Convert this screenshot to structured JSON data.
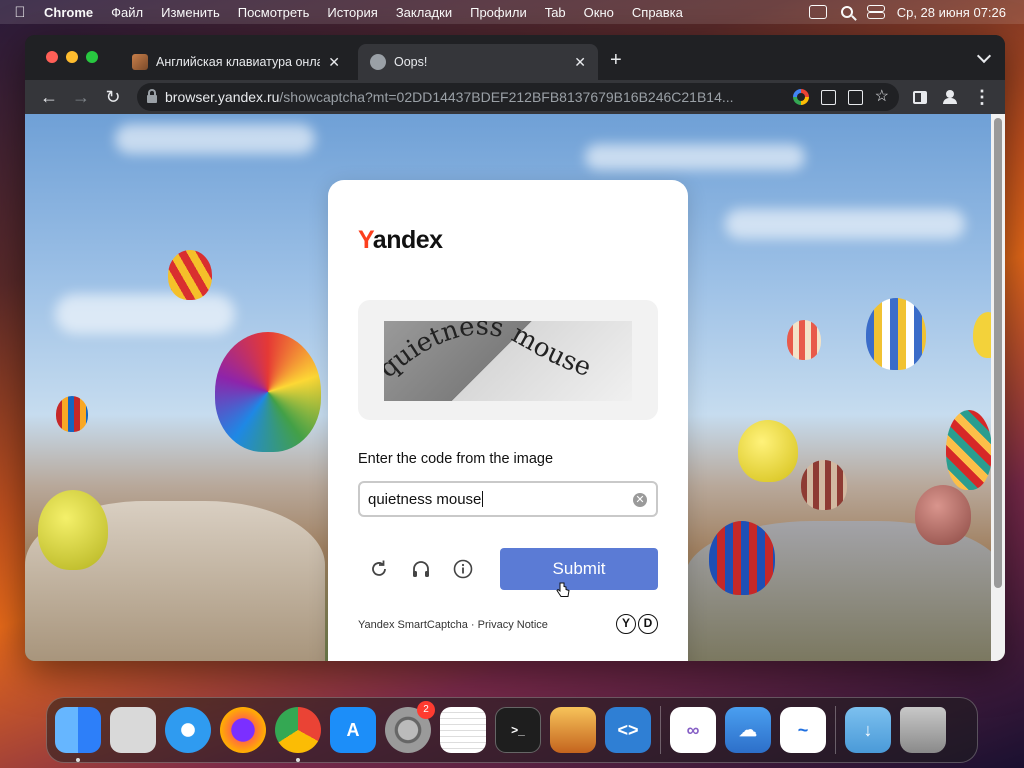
{
  "menubar": {
    "app_name": "Chrome",
    "items": [
      "Файл",
      "Изменить",
      "Посмотреть",
      "История",
      "Закладки",
      "Профили",
      "Tab",
      "Окно",
      "Справка"
    ],
    "datetime": "Ср, 28 июня  07:26"
  },
  "browser": {
    "tabs": [
      {
        "title": "Английская клавиатура онлайн",
        "favicon": "tab-favicon"
      },
      {
        "title": "Oops!",
        "favicon": "globe-icon"
      }
    ],
    "new_tab_label": "+",
    "url_host": "browser.yandex.ru",
    "url_path": "/showcaptcha?mt=02DD14437BDEF212BFB8137679B16B246C21B14..."
  },
  "page": {
    "logo_y": "Y",
    "logo_rest": "andex",
    "captcha_text": "quietness mouse",
    "input_label": "Enter the code from the image",
    "input_value": "quietness mouse",
    "submit_label": "Submit",
    "footer_text": "Yandex SmartCaptcha · Privacy Notice",
    "footer_logo_1": "Y",
    "footer_logo_2": "D"
  },
  "dock": {
    "apps": [
      {
        "name": "Finder",
        "color": "#3b82f6"
      },
      {
        "name": "Launchpad",
        "color": "#cfcfcf"
      },
      {
        "name": "Safari",
        "color": "#2f9bf0"
      },
      {
        "name": "Firefox",
        "color": "#ff7139"
      },
      {
        "name": "Chrome",
        "color": "#ffffff"
      },
      {
        "name": "App Store",
        "color": "#1c8ef9"
      },
      {
        "name": "System Settings",
        "color": "#8e8e93",
        "badge": "2"
      },
      {
        "name": "TextEdit",
        "color": "#f5f5f5"
      },
      {
        "name": "Terminal",
        "color": "#1e1e1e"
      },
      {
        "name": "GarageBand",
        "color": "#f2a33a"
      },
      {
        "name": "VS Code",
        "color": "#2f7fd4"
      },
      {
        "name": "Visual Studio",
        "color": "#ffffff"
      },
      {
        "name": "Weather",
        "color": "#3a8fe0"
      },
      {
        "name": "Freeform",
        "color": "#ffffff"
      },
      {
        "name": "Downloads",
        "color": "#5aa7e0"
      },
      {
        "name": "Trash",
        "color": "#9a9a9a"
      }
    ]
  },
  "colors": {
    "submit": "#5b7bd5",
    "yandex_red": "#fc3f1d",
    "chrome_dark": "#202124"
  }
}
